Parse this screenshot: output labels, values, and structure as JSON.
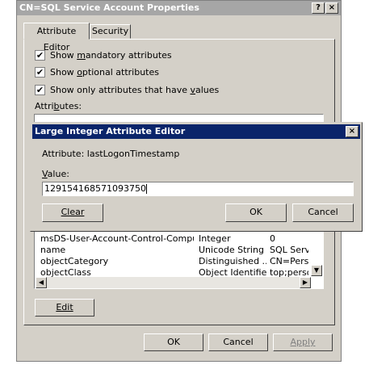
{
  "window": {
    "title": "CN=SQL Service Account Properties",
    "help_button": "?",
    "close_button": "×"
  },
  "tabs": [
    {
      "label": "Attribute Editor",
      "selected": true
    },
    {
      "label": "Security",
      "selected": false
    }
  ],
  "options": [
    {
      "label": "Show mandatory attributes",
      "checked": true
    },
    {
      "label": "Show optional attributes",
      "checked": true
    },
    {
      "label": "Show only attributes that have values",
      "checked": true
    }
  ],
  "attributes_label": "Attributes:",
  "attribute_rows": [
    {
      "attribute": "msDS-User-Account-Control-Computed",
      "syntax": "Integer",
      "value": "0"
    },
    {
      "attribute": "name",
      "syntax": "Unicode String",
      "value": "SQL Servi"
    },
    {
      "attribute": "objectCategory",
      "syntax": "Distinguished ...",
      "value": "CN=Perso"
    },
    {
      "attribute": "objectClass",
      "syntax": "Object Identifier",
      "value": "top;person"
    }
  ],
  "edit_button": "Edit",
  "footer": {
    "ok": "OK",
    "cancel": "Cancel",
    "apply": "Apply"
  },
  "dialog": {
    "title": "Large Integer Attribute Editor",
    "close_button": "×",
    "attribute_text": "Attribute:  lastLogonTimestamp",
    "value_label": "Value:",
    "value": "129154168571093750",
    "clear_button": "Clear",
    "ok_button": "OK",
    "cancel_button": "Cancel"
  }
}
